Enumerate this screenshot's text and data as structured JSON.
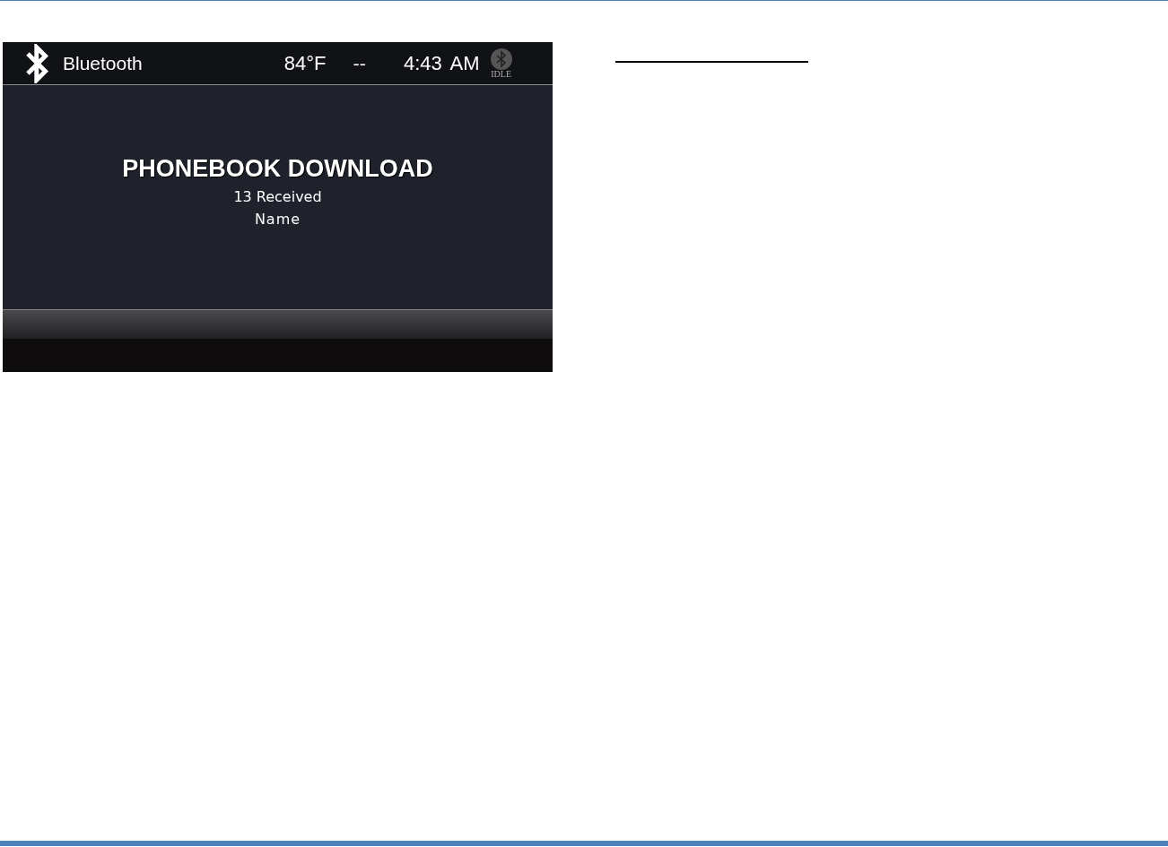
{
  "header": {
    "title": "Bluetooth",
    "temperature": "84°F",
    "separator": "--",
    "time": "4:43 AM",
    "status": "IDLE"
  },
  "content": {
    "heading": "PHONEBOOK DOWNLOAD",
    "count": "13 Received",
    "field": "Name"
  }
}
